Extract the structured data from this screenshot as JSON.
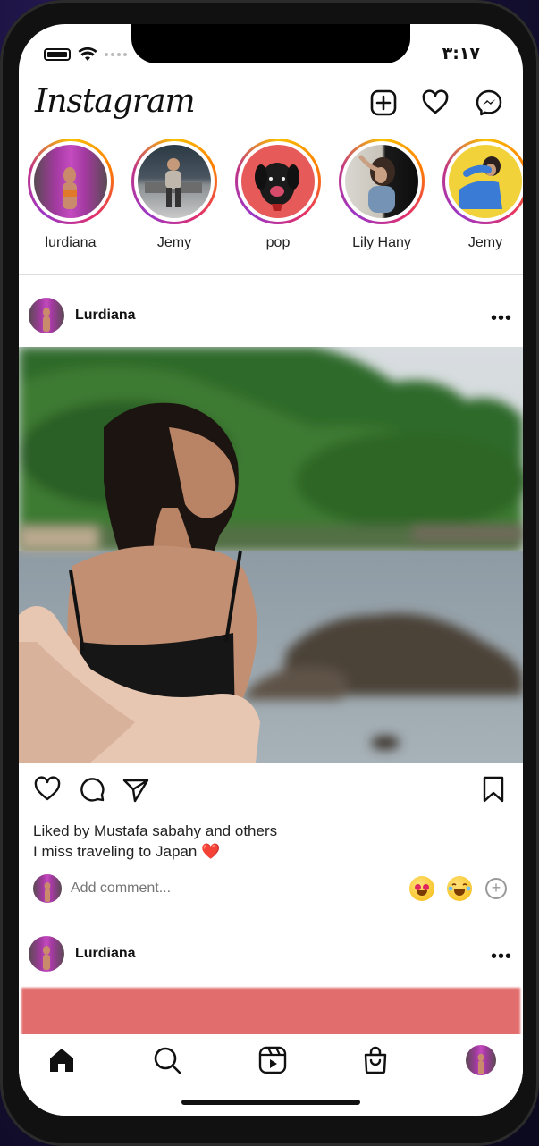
{
  "status": {
    "time": "٣:١٧"
  },
  "app": {
    "logo": "Instagram"
  },
  "header_icons": [
    "plus-square-icon",
    "heart-icon",
    "messenger-icon"
  ],
  "stories": [
    {
      "label": "lurdiana"
    },
    {
      "label": "Jemy"
    },
    {
      "label": "pop"
    },
    {
      "label": "Lily Hany"
    },
    {
      "label": "Jemy"
    }
  ],
  "post": {
    "username": "Lurdiana",
    "likes_text": "Liked by Mustafa sabahy and others",
    "caption": "I miss traveling to Japan",
    "caption_emoji": "❤️",
    "comment_placeholder": "Add comment..."
  },
  "post2": {
    "username": "Lurdiana"
  },
  "tabs": [
    "home-icon",
    "search-icon",
    "reels-icon",
    "shop-icon",
    "profile-avatar"
  ],
  "colors": {
    "accent_ring_start": "#f9c100",
    "accent_ring_end": "#c13584",
    "heart_red": "#c62828"
  }
}
